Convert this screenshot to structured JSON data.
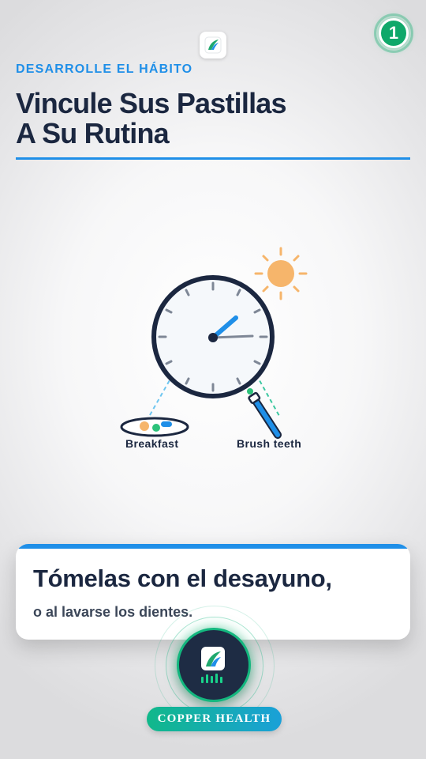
{
  "header": {
    "kicker": "DESARROLLE EL HÁBITO",
    "title_line1": "Vincule Sus Pastillas",
    "title_line2": "A Su Rutina",
    "step_number": "1"
  },
  "illustration": {
    "labels": {
      "breakfast": "Breakfast",
      "brush_teeth": "Brush teeth"
    },
    "icons": [
      "clock-icon",
      "sun-icon",
      "plate-icon",
      "toothbrush-icon"
    ]
  },
  "card": {
    "headline": "Tómelas con el desayuno,",
    "subtext": "o al lavarse los dientes."
  },
  "brand": {
    "name": "COPPER HEALTH",
    "icon": "copper-health-logo-icon"
  },
  "colors": {
    "accent_blue": "#1f8fe8",
    "navy": "#1b2740",
    "brand_green": "#13b77e",
    "sun_orange": "#f6b56b"
  }
}
